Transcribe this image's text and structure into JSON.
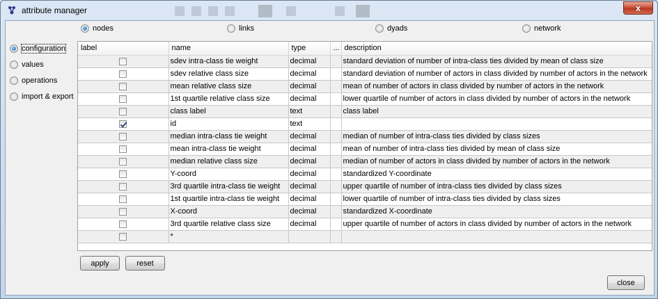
{
  "window": {
    "title": "attribute manager",
    "close_glyph": "x"
  },
  "top_radios": [
    {
      "label": "nodes",
      "selected": true
    },
    {
      "label": "links",
      "selected": false
    },
    {
      "label": "dyads",
      "selected": false
    },
    {
      "label": "network",
      "selected": false
    }
  ],
  "side_radios": [
    {
      "label": "configuration",
      "selected": true
    },
    {
      "label": "values",
      "selected": false
    },
    {
      "label": "operations",
      "selected": false
    },
    {
      "label": "import & export",
      "selected": false
    }
  ],
  "table": {
    "columns": [
      "label",
      "name",
      "type",
      "...",
      "description"
    ],
    "rows": [
      {
        "checked": false,
        "name": "sdev intra-class tie weight",
        "type": "decimal",
        "description": "standard deviation of number of intra-class ties divided by mean of class size"
      },
      {
        "checked": false,
        "name": "sdev relative class size",
        "type": "decimal",
        "description": "standard deviation of number of actors in class divided by number of actors in the network"
      },
      {
        "checked": false,
        "name": "mean relative class size",
        "type": "decimal",
        "description": "mean of number of actors in class divided by number of actors in the network"
      },
      {
        "checked": false,
        "name": "1st quartile relative class size",
        "type": "decimal",
        "description": "lower quartile of number of actors in class divided by number of actors in the network"
      },
      {
        "checked": false,
        "name": "class label",
        "type": "text",
        "description": "class label"
      },
      {
        "checked": true,
        "name": "id",
        "type": "text",
        "description": ""
      },
      {
        "checked": false,
        "name": "median intra-class tie weight",
        "type": "decimal",
        "description": "median of number of intra-class ties divided by class sizes"
      },
      {
        "checked": false,
        "name": "mean intra-class tie weight",
        "type": "decimal",
        "description": "mean of number of intra-class ties divided by mean of class size"
      },
      {
        "checked": false,
        "name": "median relative class size",
        "type": "decimal",
        "description": "median of number of actors in class divided by number of actors in the network"
      },
      {
        "checked": false,
        "name": "Y-coord",
        "type": "decimal",
        "description": "standardized Y-coordinate"
      },
      {
        "checked": false,
        "name": "3rd quartile intra-class tie weight",
        "type": "decimal",
        "description": "upper quartile of number of intra-class ties divided by class sizes"
      },
      {
        "checked": false,
        "name": "1st quartile intra-class tie weight",
        "type": "decimal",
        "description": "lower quartile of number of intra-class ties divided by class sizes"
      },
      {
        "checked": false,
        "name": "X-coord",
        "type": "decimal",
        "description": "standardized X-coordinate"
      },
      {
        "checked": false,
        "name": "3rd quartile relative class size",
        "type": "decimal",
        "description": "upper quartile of number of actors in class divided by number of actors in the network"
      },
      {
        "checked": false,
        "name": "*",
        "type": "",
        "description": ""
      }
    ]
  },
  "buttons": {
    "apply": "apply",
    "reset": "reset",
    "close": "close"
  },
  "colors": {
    "radio_selected": "#1a5fb4",
    "close_button": "#c9503a"
  }
}
